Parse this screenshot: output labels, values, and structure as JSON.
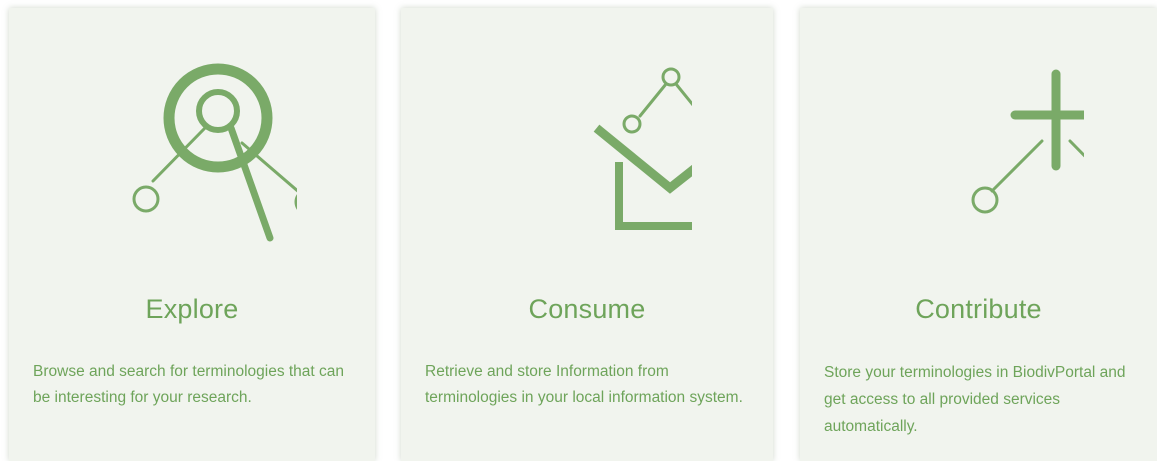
{
  "accent_color": "#7aaa68",
  "background_color": "#f1f4ee",
  "cards": [
    {
      "icon": "explore-magnifier-icon",
      "title": "Explore",
      "description": "Browse and search for terminologies that can be interesting for your research."
    },
    {
      "icon": "consume-inbox-icon",
      "title": "Consume",
      "description": "Retrieve and store Information from terminologies in your local information system."
    },
    {
      "icon": "contribute-plus-icon",
      "title": "Contribute",
      "description": "Store your terminologies in BiodivPortal and get access to all provided services automatically."
    }
  ]
}
